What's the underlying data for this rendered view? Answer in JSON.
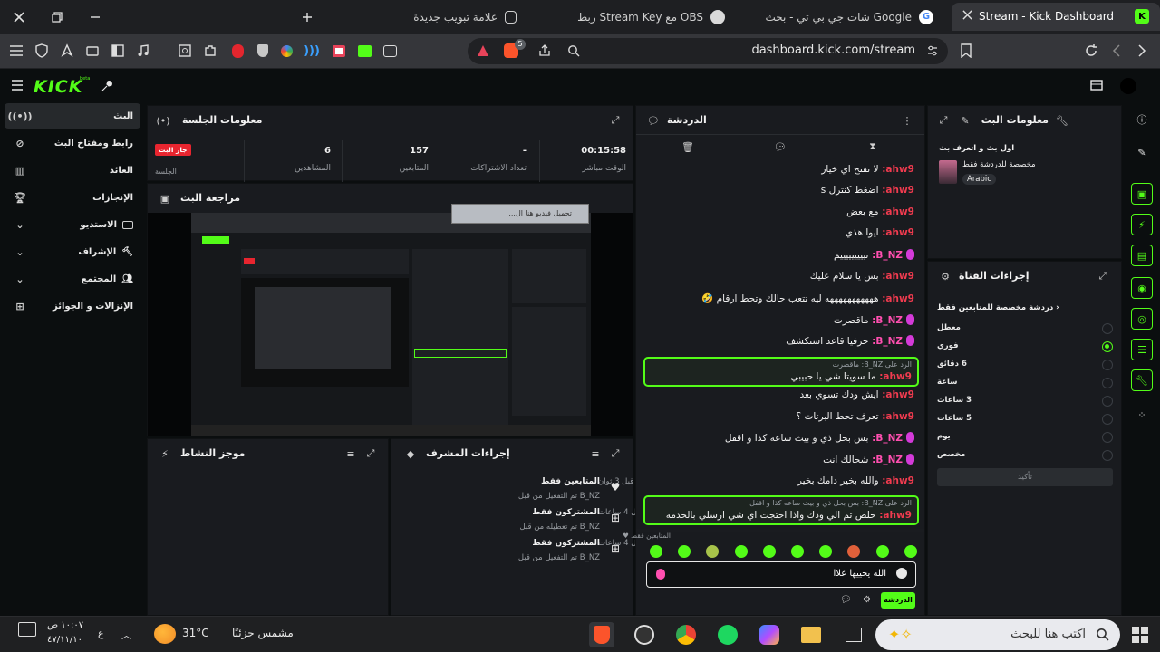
{
  "browser": {
    "tabs": [
      {
        "title": "Stream - Kick Dashboard",
        "active": true
      },
      {
        "title": "شات جي بي تي - بحث Google",
        "active": false
      },
      {
        "title": "ربط Stream Key مع OBS",
        "active": false
      },
      {
        "title": "علامة تبويب جديدة",
        "active": false
      }
    ],
    "url": "dashboard.kick.com/stream",
    "ext_badge": "5"
  },
  "kick": {
    "logo": "KICK",
    "logo_sup": "beta"
  },
  "nav": {
    "items": [
      {
        "label": "البث"
      },
      {
        "label": "رابط ومفتاح البث"
      },
      {
        "label": "العائد"
      },
      {
        "label": "الإنجازات"
      },
      {
        "label": "الاستديو"
      },
      {
        "label": "الإشراف"
      },
      {
        "label": "المجتمع"
      },
      {
        "label": "الإنزالات و الجوائز"
      }
    ]
  },
  "session": {
    "title": "معلومات الجلسة",
    "badge": "جار البث",
    "badge_label": "الجلسة",
    "stats": [
      {
        "value": "00:15:58",
        "label": "الوقت مباشر"
      },
      {
        "value": "-",
        "label": "تعداد الاشتراكات"
      },
      {
        "value": "157",
        "label": "المتابعين"
      },
      {
        "value": "6",
        "label": "المشاهدين"
      }
    ]
  },
  "preview": {
    "title": "مراجعة البث",
    "popup_text": "تحميل فيديو هنا ال..."
  },
  "activity": {
    "title": "موجز النشاط"
  },
  "mod_actions": {
    "title": "إجراءات المشرف",
    "rows": [
      {
        "title": "المتابعين فقط",
        "sub": "B_NZ تم التفعيل من قبل",
        "time": "قبل 3 ثوان"
      },
      {
        "title": "المشتركون فقط",
        "sub": "B_NZ تم تعطيله من قبل",
        "time": "قبل 4 ساعات"
      },
      {
        "title": "المشتركون فقط",
        "sub": "B_NZ تم التفعيل من قبل",
        "time": "قبل 4 ساعات"
      }
    ]
  },
  "chat": {
    "title": "الدردشة",
    "messages": [
      {
        "user": "ahw9",
        "text": "لا تفتح اي خيار"
      },
      {
        "user": "ahw9",
        "text": "اضغط كنترل s"
      },
      {
        "user": "ahw9",
        "text": "مع بعض"
      },
      {
        "user": "ahw9",
        "text": "ايوا هذي"
      },
      {
        "user": "B_NZ",
        "text": "تيييييييييم"
      },
      {
        "user": "ahw9",
        "text": "بس يا سلام عليك"
      },
      {
        "user": "ahw9",
        "text": "هههههههههههه ليه تتعب حالك وتحط ارقام 🤣"
      },
      {
        "user": "B_NZ",
        "text": "ماقصرت"
      },
      {
        "user": "B_NZ",
        "text": "حرفيا قاعد استكشف"
      },
      {
        "user": "ahw9",
        "text": "ايش ودك تسوي بعد"
      },
      {
        "user": "ahw9",
        "text": "تعرف تحط البرتات ؟"
      },
      {
        "user": "B_NZ",
        "text": "بس بحل ذي و بيث ساعه كذا و اقفل"
      },
      {
        "user": "B_NZ",
        "text": "شحالك انت"
      },
      {
        "user": "ahw9",
        "text": "والله بخير دامك بخير"
      }
    ],
    "reply1": {
      "context": "الرد على B_NZ: ماقصرت",
      "user": "ahw9",
      "text": "ما سويتا شي يا حبيبي"
    },
    "reply2": {
      "context": "الرد على B_NZ: بس بحل ذي و بيث ساعه كذا و اقفل",
      "user": "ahw9",
      "text": "خلص تم الي ودك واذا احتجت اي شي ارسلي بالخدمه"
    },
    "mode_label": "المتابعين فقط ♥",
    "input_value": "الله يحييها علاا",
    "send_label": "الدردشة",
    "emote_colors": [
      "#53fc18",
      "#53fc18",
      "#a7c34a",
      "#53fc18",
      "#53fc18",
      "#53fc18",
      "#53fc18",
      "#e0603a",
      "#53fc18",
      "#53fc18"
    ]
  },
  "stream_info": {
    "title": "معلومات البث",
    "stream_title": "اول بث و اتعرف بث",
    "category": "مخصصة للدردشة فقط",
    "language": "Arabic"
  },
  "channel_actions": {
    "title": "إجراءات القناة",
    "submenu": "دردشة مخصصة للمتابعين فقط",
    "options": [
      {
        "label": "معطل",
        "on": false
      },
      {
        "label": "فوري",
        "on": true
      },
      {
        "label": "6 دقائق",
        "on": false
      },
      {
        "label": "ساعة",
        "on": false
      },
      {
        "label": "3 ساعات",
        "on": false
      },
      {
        "label": "5 ساعات",
        "on": false
      },
      {
        "label": "يوم",
        "on": false
      },
      {
        "label": "مخصص",
        "on": false
      }
    ],
    "confirm_label": "تأكيد"
  },
  "taskbar": {
    "search_placeholder": "اكتب هنا للبحث",
    "weather_temp": "31°C",
    "weather_text": "مشمس جزئيًا",
    "time": "١٠:٠٧ ص",
    "date": "٤٧/١١/١٠",
    "lang": "ع"
  }
}
